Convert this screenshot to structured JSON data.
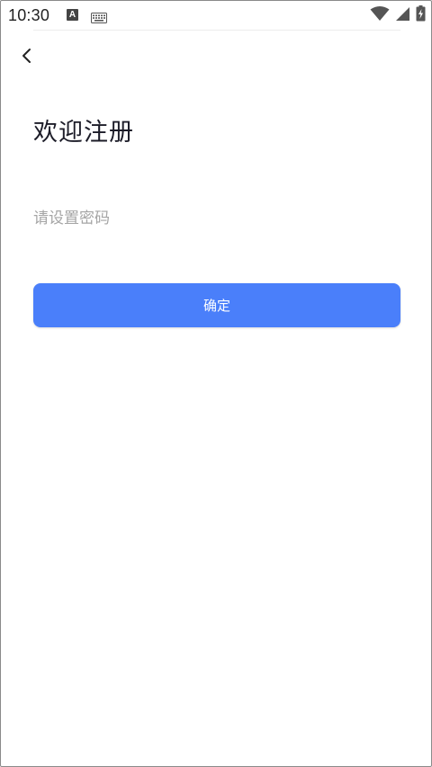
{
  "status_bar": {
    "time": "10:30",
    "a_badge": "A",
    "icons": [
      "a-badge-icon",
      "keyboard-icon",
      "wifi-icon",
      "signal-icon",
      "battery-charging-icon"
    ]
  },
  "header": {
    "back_icon": "chevron-left-icon"
  },
  "main": {
    "title": "欢迎注册",
    "password_placeholder": "请设置密码",
    "password_value": "",
    "confirm_label": "确定"
  },
  "colors": {
    "primary": "#4a7ffa",
    "title_text": "#1c1c28",
    "placeholder": "#a5a5a5"
  }
}
